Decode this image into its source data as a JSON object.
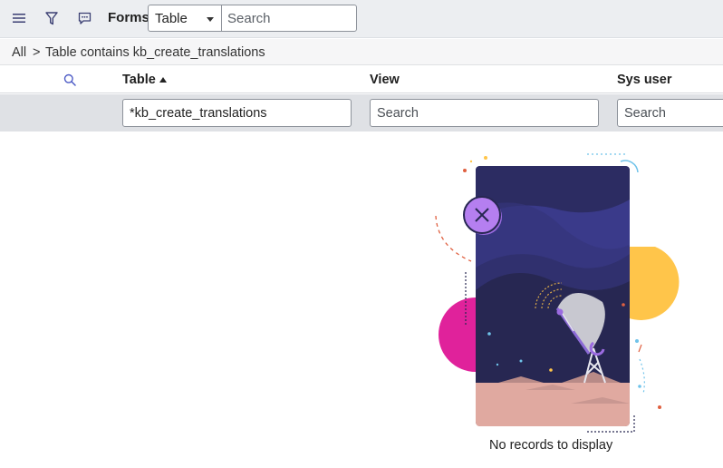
{
  "toolbar": {
    "menu_icon": "hamburger-menu-icon",
    "filter_icon": "funnel-filter-icon",
    "chat_icon": "chat-bubble-icon",
    "title": "Forms",
    "select_value": "Table",
    "search_placeholder": "Search"
  },
  "breadcrumb": {
    "all": "All",
    "separator": ">",
    "filter": "Table contains kb_create_translations"
  },
  "columns": {
    "search_icon": "magnifier-icon",
    "table": "Table",
    "view": "View",
    "sys_user": "Sys user"
  },
  "filters": {
    "table_value": "*kb_create_translations",
    "view_placeholder": "Search",
    "sys_user_placeholder": "Search"
  },
  "empty_state": {
    "message": "No records to display",
    "illustration": "satellite-dish-empty-state"
  },
  "colors": {
    "accent": "#5b4dc8",
    "sky": "#2f2d63",
    "ground": "#e0a9a0",
    "magenta": "#e0229b",
    "yellow": "#ffc54a"
  }
}
